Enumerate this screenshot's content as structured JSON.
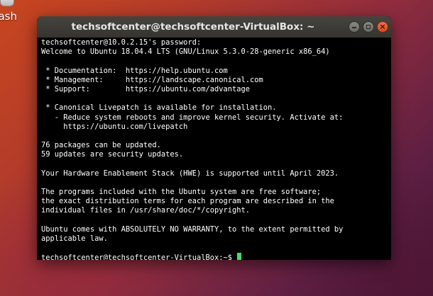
{
  "desktop": {
    "trash_label": "ash"
  },
  "window": {
    "title": "techsoftcenter@techsoftcenter-VirtualBox: ~",
    "close_glyph": "×"
  },
  "terminal": {
    "lines": [
      "techsoftcenter@10.0.2.15's password:",
      "Welcome to Ubuntu 18.04.4 LTS (GNU/Linux 5.3.0-28-generic x86_64)",
      "",
      " * Documentation:  https://help.ubuntu.com",
      " * Management:     https://landscape.canonical.com",
      " * Support:        https://ubuntu.com/advantage",
      "",
      " * Canonical Livepatch is available for installation.",
      "   - Reduce system reboots and improve kernel security. Activate at:",
      "     https://ubuntu.com/livepatch",
      "",
      "76 packages can be updated.",
      "59 updates are security updates.",
      "",
      "Your Hardware Enablement Stack (HWE) is supported until April 2023.",
      "",
      "The programs included with the Ubuntu system are free software;",
      "the exact distribution terms for each program are described in the",
      "individual files in /usr/share/doc/*/copyright.",
      "",
      "Ubuntu comes with ABSOLUTELY NO WARRANTY, to the extent permitted by",
      "applicable law.",
      ""
    ],
    "prompt": "techsoftcenter@techsoftcenter-VirtualBox:~$ "
  },
  "colors": {
    "terminal_bg": "#000000",
    "terminal_fg": "#ffffff",
    "cursor": "#3fe06a",
    "close_button": "#e05a2b",
    "titlebar": "#3d3c37"
  }
}
